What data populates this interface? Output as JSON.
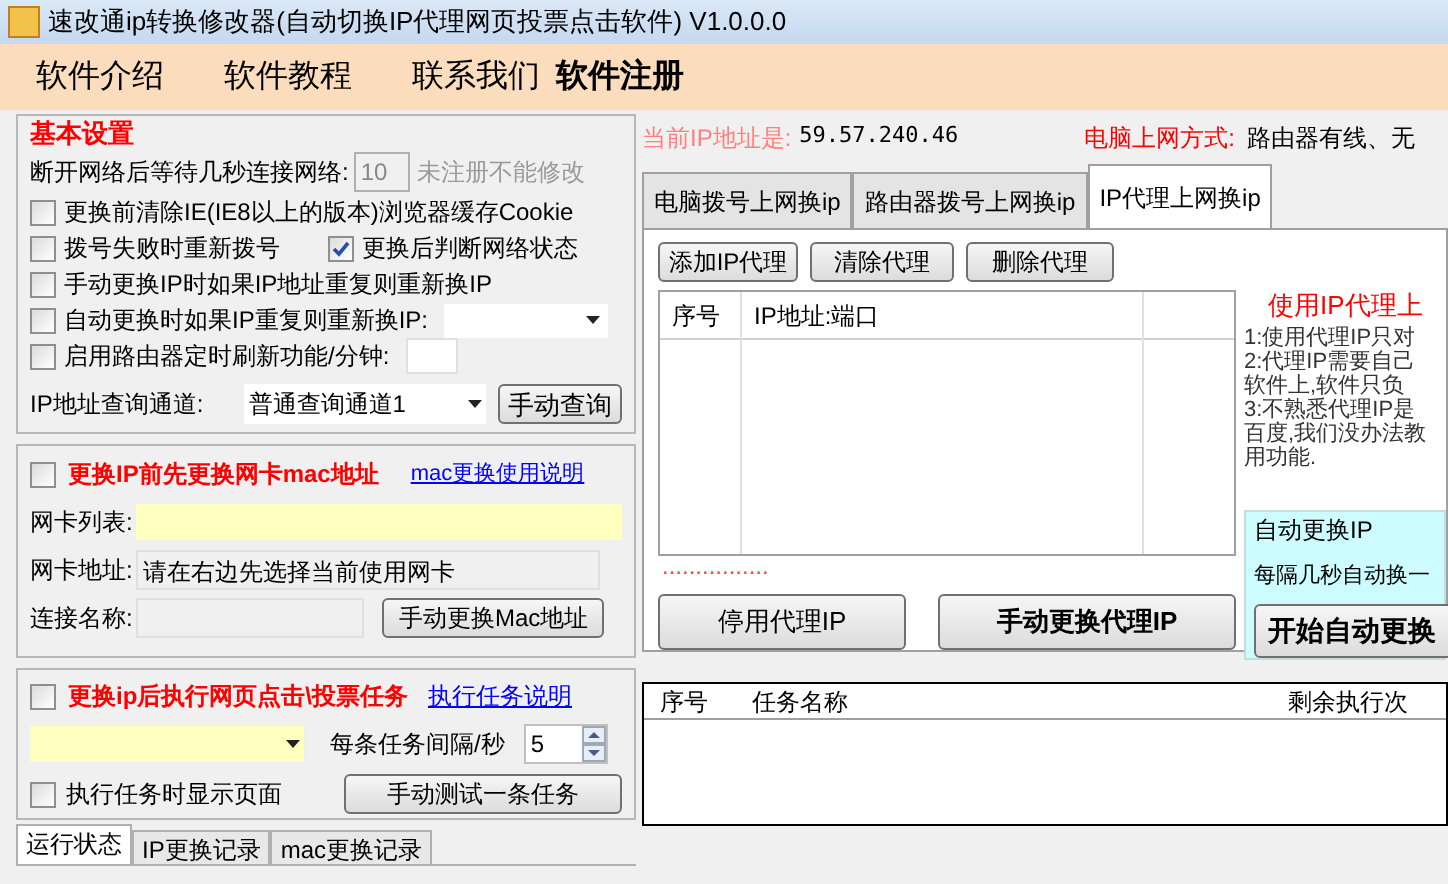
{
  "window": {
    "title": "速改通ip转换修改器(自动切换IP代理网页投票点击软件) V1.0.0.0"
  },
  "menu": [
    {
      "label": "软件介绍",
      "bold": false
    },
    {
      "label": "软件教程",
      "bold": false
    },
    {
      "label": "联系我们",
      "bold": false
    },
    {
      "label": "软件注册",
      "bold": true
    }
  ],
  "basic_settings": {
    "title": "基本设置",
    "wait_label": "断开网络后等待几秒连接网络:",
    "wait_value": "10",
    "wait_note": "未注册不能修改",
    "option_rows": [
      {
        "kind": "plain",
        "items": [
          {
            "label": "更换前清除IE(IE8以上的版本)浏览器缓存Cookie",
            "checked": false
          }
        ]
      },
      {
        "kind": "plain",
        "items": [
          {
            "label": "拨号失败时重新拨号",
            "checked": false
          },
          {
            "label": "更换后判断网络状态",
            "checked": true
          }
        ]
      },
      {
        "kind": "plain",
        "items": [
          {
            "label": "手动更换IP时如果IP地址重复则重新换IP",
            "checked": false
          }
        ]
      },
      {
        "kind": "select",
        "items": [
          {
            "label": "自动更换时如果IP重复则重新换IP:",
            "checked": false
          }
        ]
      },
      {
        "kind": "input",
        "items": [
          {
            "label": "启用路由器定时刷新功能/分钟:",
            "checked": false
          }
        ]
      }
    ],
    "query_label": "IP地址查询通道:",
    "query_channel": "普通查询通道1",
    "query_button": "手动查询"
  },
  "mac": {
    "checked": false,
    "title": "更换IP前先更换网卡mac地址",
    "help_link": "mac更换使用说明",
    "fields": [
      {
        "label": "网卡列表:",
        "kind": "highlight"
      },
      {
        "label": "网卡地址:",
        "kind": "text",
        "value": "请在右边先选择当前使用网卡"
      },
      {
        "label": "连接名称:",
        "kind": "short"
      }
    ],
    "button": "手动更换Mac地址"
  },
  "task": {
    "checked": false,
    "title": "更换ip后执行网页点击\\投票任务",
    "help_link": "执行任务说明",
    "interval_label": "每条任务间隔/秒",
    "interval_value": "5",
    "show_page": {
      "label": "执行任务时显示页面",
      "checked": false
    },
    "test_button": "手动测试一条任务"
  },
  "log_tabs": [
    {
      "label": "运行状态",
      "selected": true
    },
    {
      "label": "IP更换记录",
      "selected": false
    },
    {
      "label": "mac更换记录",
      "selected": false
    }
  ],
  "status": {
    "ip_label": "当前IP地址是:",
    "ip_value": "59.57.240.46",
    "net_label": "电脑上网方式:",
    "net_value": "路由器有线、无"
  },
  "main_tabs": [
    {
      "label": "电脑拨号上网换ip",
      "selected": false
    },
    {
      "label": "路由器拨号上网换ip",
      "selected": false
    },
    {
      "label": "IP代理上网换ip",
      "selected": true
    }
  ],
  "proxy": {
    "buttons": [
      "添加IP代理",
      "清除代理",
      "删除代理"
    ],
    "columns": [
      "序号",
      "IP地址:端口"
    ],
    "dots": "................",
    "stop_button": "停用代理IP",
    "manual_button": "手动更换代理IP",
    "info_title": "使用IP代理上",
    "info_lines": [
      "1:使用代理IP只对",
      "2:代理IP需要自己",
      "软件上,软件只负",
      "3:不熟悉代理IP是",
      "百度,我们没办法教",
      "用功能."
    ],
    "auto_title": "自动更换IP",
    "auto_text": "每隔几秒自动换一",
    "start_button": "开始自动更换"
  },
  "task_table": {
    "columns": [
      "序号",
      "任务名称",
      "剩余执行次"
    ]
  }
}
